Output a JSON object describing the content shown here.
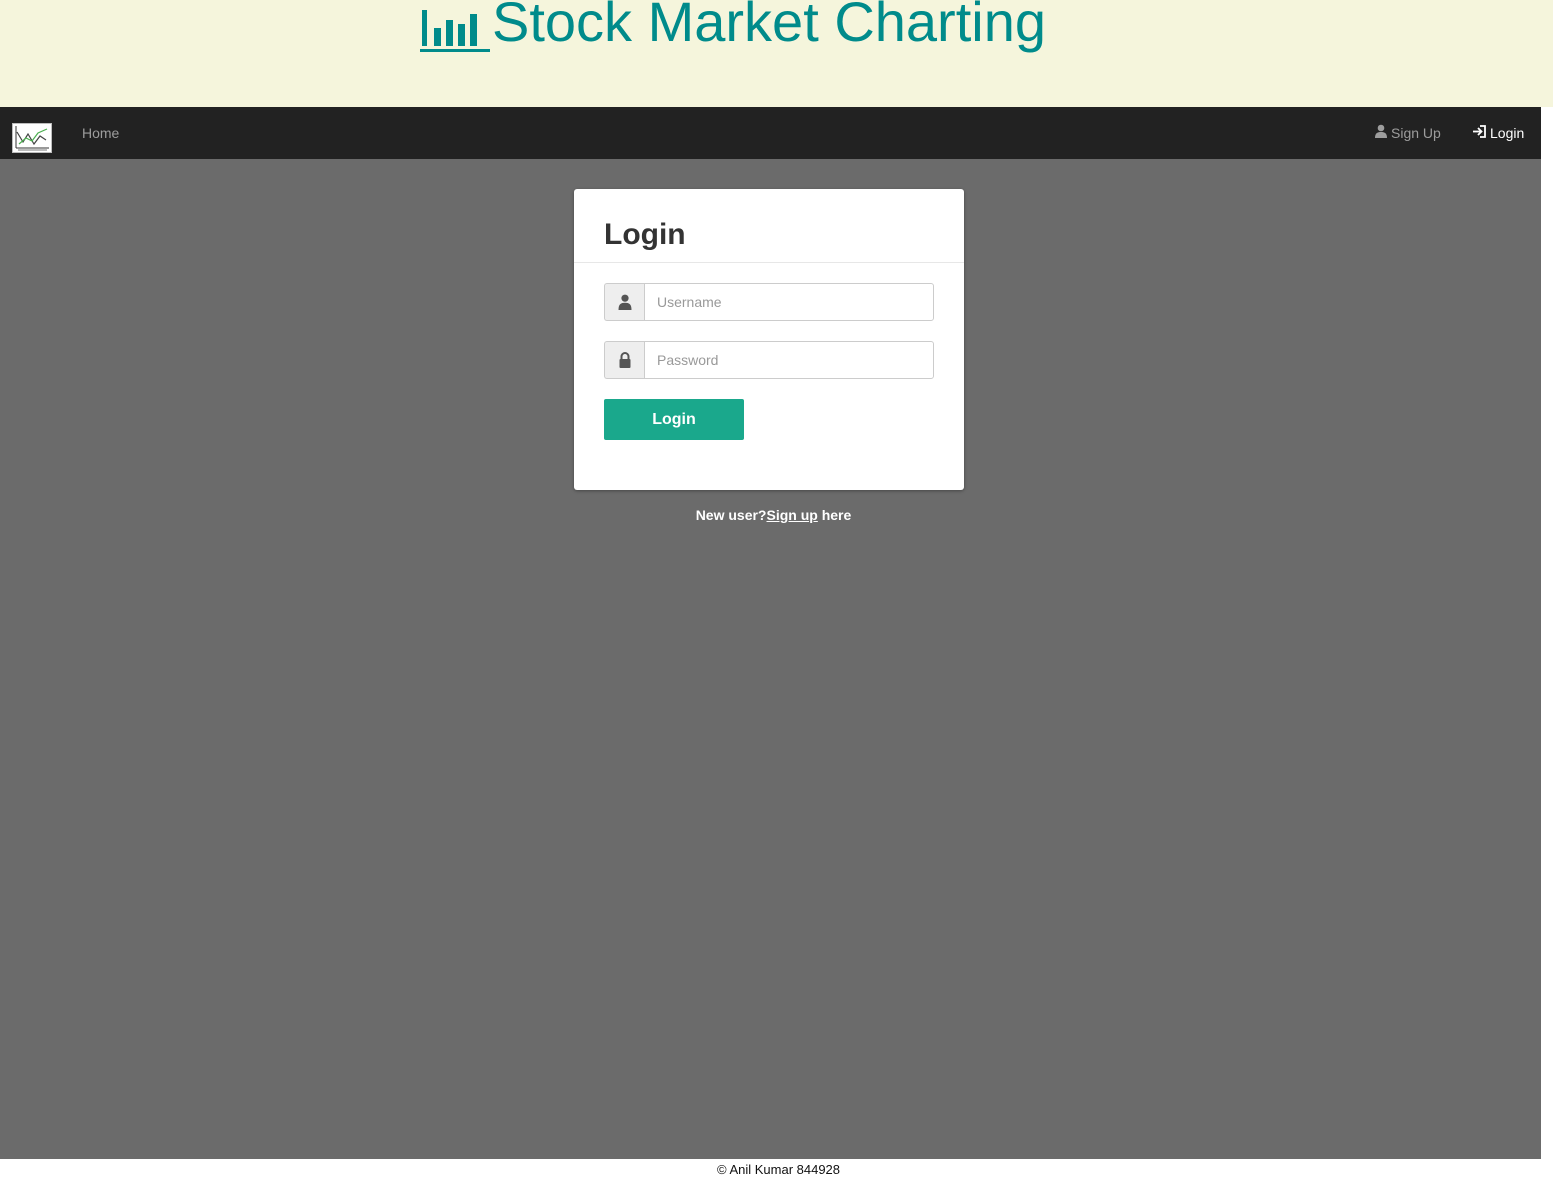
{
  "banner": {
    "title": "Stock Market Charting",
    "icon": "bar-chart-icon"
  },
  "navbar": {
    "logo_icon": "stock-chart-logo-icon",
    "home_label": "Home",
    "signup_label": "Sign Up",
    "signup_icon": "user-icon",
    "login_label": "Login",
    "login_icon": "log-in-icon"
  },
  "login_card": {
    "title": "Login",
    "username_placeholder": "Username",
    "username_value": "",
    "username_icon": "user-icon",
    "password_placeholder": "Password",
    "password_value": "",
    "password_icon": "lock-icon",
    "submit_label": "Login"
  },
  "signup_note": {
    "prefix": "New user?",
    "link": "Sign up",
    "suffix": " here"
  },
  "footer": {
    "text": "© Anil Kumar 844928"
  },
  "colors": {
    "banner_bg": "#f5f5dc",
    "banner_text": "#008b8b",
    "navbar_bg": "#222222",
    "page_bg": "#6b6b6b",
    "button_bg": "#1aa88c"
  }
}
